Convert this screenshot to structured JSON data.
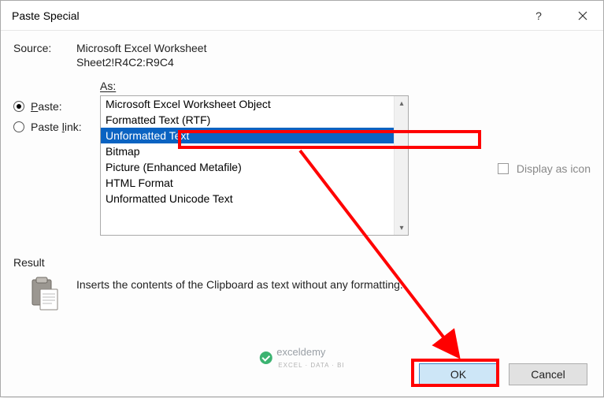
{
  "title": "Paste Special",
  "source_label": "Source:",
  "source_app": "Microsoft Excel Worksheet",
  "source_range": "Sheet2!R4C2:R9C4",
  "radios": {
    "paste": "Paste:",
    "paste_link": "Paste link:"
  },
  "as_label": "As:",
  "as_items": [
    "Microsoft Excel Worksheet Object",
    "Formatted Text (RTF)",
    "Unformatted Text",
    "Bitmap",
    "Picture (Enhanced Metafile)",
    "HTML Format",
    "Unformatted Unicode Text"
  ],
  "selected_index": 2,
  "display_as_icon": "Display as icon",
  "result_label": "Result",
  "result_text": "Inserts the contents of the Clipboard as text without any formatting.",
  "buttons": {
    "ok": "OK",
    "cancel": "Cancel"
  },
  "watermark": {
    "brand": "exceldemy",
    "tag": "EXCEL · DATA · BI"
  }
}
